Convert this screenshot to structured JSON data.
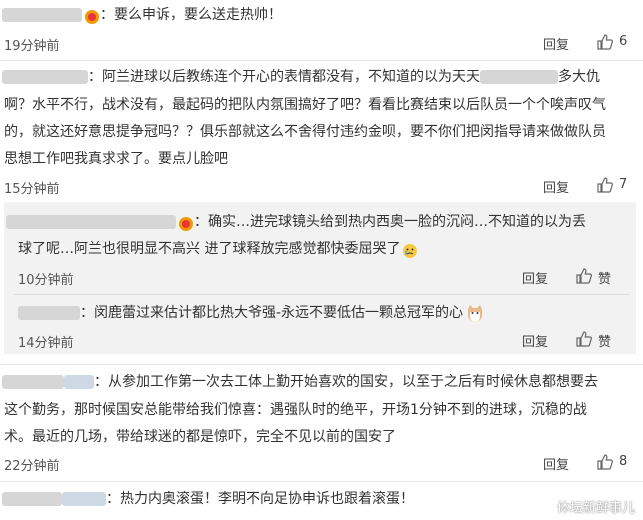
{
  "comments": [
    {
      "line1": "：要么申诉，要么送走热帅！",
      "time": "19分钟前",
      "reply": "回复",
      "likes": "6"
    },
    {
      "line1a": "：阿兰进球以后教练连个开心的表情都没有，不知道的以为天天",
      "line1b": "多大仇",
      "line2": "啊？水平不行，战术没有，最起码的把队内氛围搞好了吧？看看比赛结束以后队员一个个唉声叹气",
      "line3": "的，就这还好意思提争冠吗？？俱乐部就这么不舍得付违约金呗，要不你们把闵指导请来做做队员",
      "line4": "思想工作吧我真求求了。要点儿脸吧",
      "time": "15分钟前",
      "reply": "回复",
      "likes": "7"
    },
    {
      "line1": "：确实…进完球镜头给到热内西奥一脸的沉闷…不知道的以为丢",
      "line2": "球了呢…阿兰也很明显不高兴 进了球释放完感觉都快委屈哭了",
      "time": "10分钟前",
      "reply": "回复",
      "likes": "赞"
    },
    {
      "line1": "：闵鹿蕾过来估计都比热大爷强-永远不要低估一颗总冠军的心",
      "time": "14分钟前",
      "reply": "回复",
      "likes": "赞"
    },
    {
      "line1": "：从参加工作第一次去工体上勤开始喜欢的国安，以至于之后有时候休息都想要去",
      "line2": "这个勤务，那时候国安总能带给我们惊喜：遇强队时的绝平，开场1分钟不到的进球，沉稳的战",
      "line3": "术。最近的几场，带给球迷的都是惊吓，完全不见以前的国安了",
      "time": "22分钟前",
      "reply": "回复",
      "likes": "8"
    },
    {
      "line1": "：热力内奥滚蛋！李明不向足协申诉也跟着滚蛋！"
    }
  ],
  "watermark": "体坛新鲜事儿",
  "icons": {
    "like": "thumbs-up-icon",
    "badge": "vip-badge-icon",
    "emoji_cry": "crying-emoji-icon",
    "emoji_cat": "cat-emoji-icon"
  },
  "colors": {
    "badge": "#f39800",
    "badge_red": "#e8353b"
  }
}
